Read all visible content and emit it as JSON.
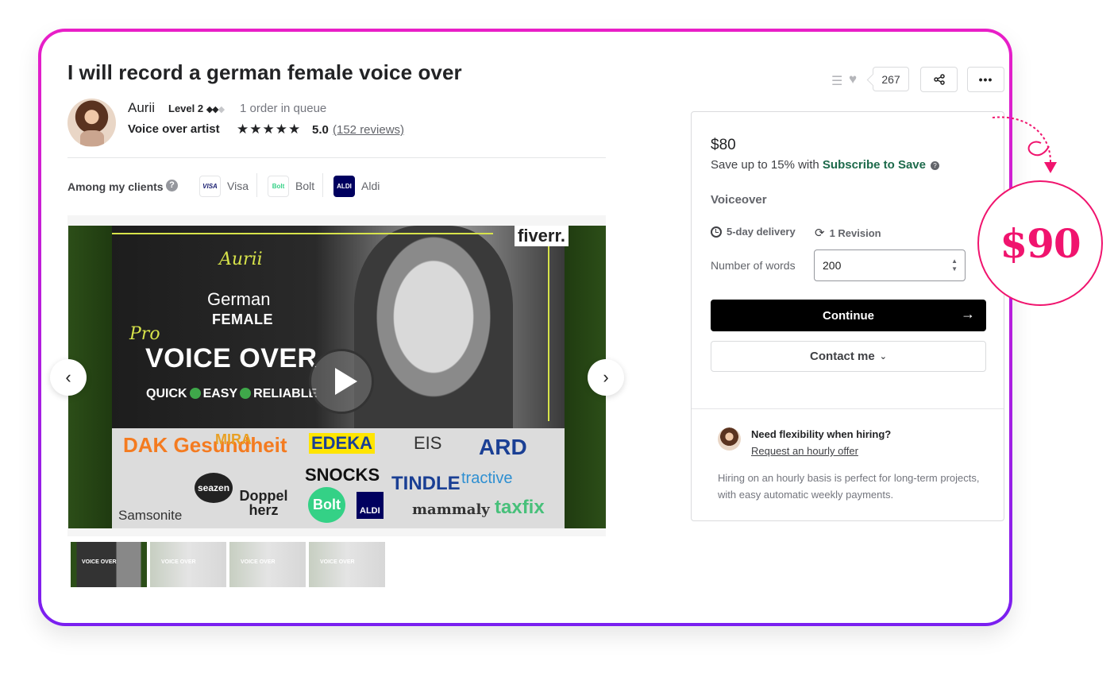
{
  "gig": {
    "title": "I will record a german female voice over"
  },
  "seller": {
    "name": "Aurii",
    "level": "Level 2",
    "queue": "1 order in queue",
    "role": "Voice over artist",
    "rating": "5.0",
    "reviews": "(152 reviews)"
  },
  "clients": {
    "label": "Among my clients",
    "items": [
      {
        "name": "Visa",
        "logo_text": "VISA",
        "color": "#1a1f71"
      },
      {
        "name": "Bolt",
        "logo_text": "Bolt",
        "color": "#34d186"
      },
      {
        "name": "Aldi",
        "logo_text": "ALDI",
        "color": "#00005f"
      }
    ]
  },
  "media": {
    "brand": "fiverr.",
    "script_name": "Aurii",
    "line1": "German",
    "line2": "FEMALE",
    "pro": "Pro",
    "headline": "VOICE OVER",
    "tags": [
      "QUICK",
      "EASY",
      "RELIABLE"
    ],
    "logos": [
      "DAK Gesundheit",
      "MIRA",
      "EDEKA",
      "EIS",
      "ARD",
      "seazen",
      "SNOCKS",
      "Samsonite",
      "Doppel herz",
      "Bolt",
      "ALDI",
      "TINDLE",
      "tractive",
      "mammaly",
      "taxfix"
    ],
    "thumb_label": "VOICE OVER"
  },
  "actions": {
    "like_count": "267"
  },
  "package": {
    "price": "$80",
    "subscribe_prefix": "Save up to 15% with ",
    "subscribe_link": "Subscribe to Save",
    "name": "Voiceover",
    "delivery": "5-day delivery",
    "revisions": "1 Revision",
    "words_label": "Number of words",
    "words_value": "200",
    "continue": "Continue",
    "contact": "Contact me"
  },
  "hourly": {
    "title": "Need flexibility when hiring?",
    "link": "Request an hourly offer",
    "desc": "Hiring on an hourly basis is perfect for long-term projects, with easy automatic weekly payments."
  },
  "badge": {
    "price": "$90",
    "color": "#f0146e"
  }
}
